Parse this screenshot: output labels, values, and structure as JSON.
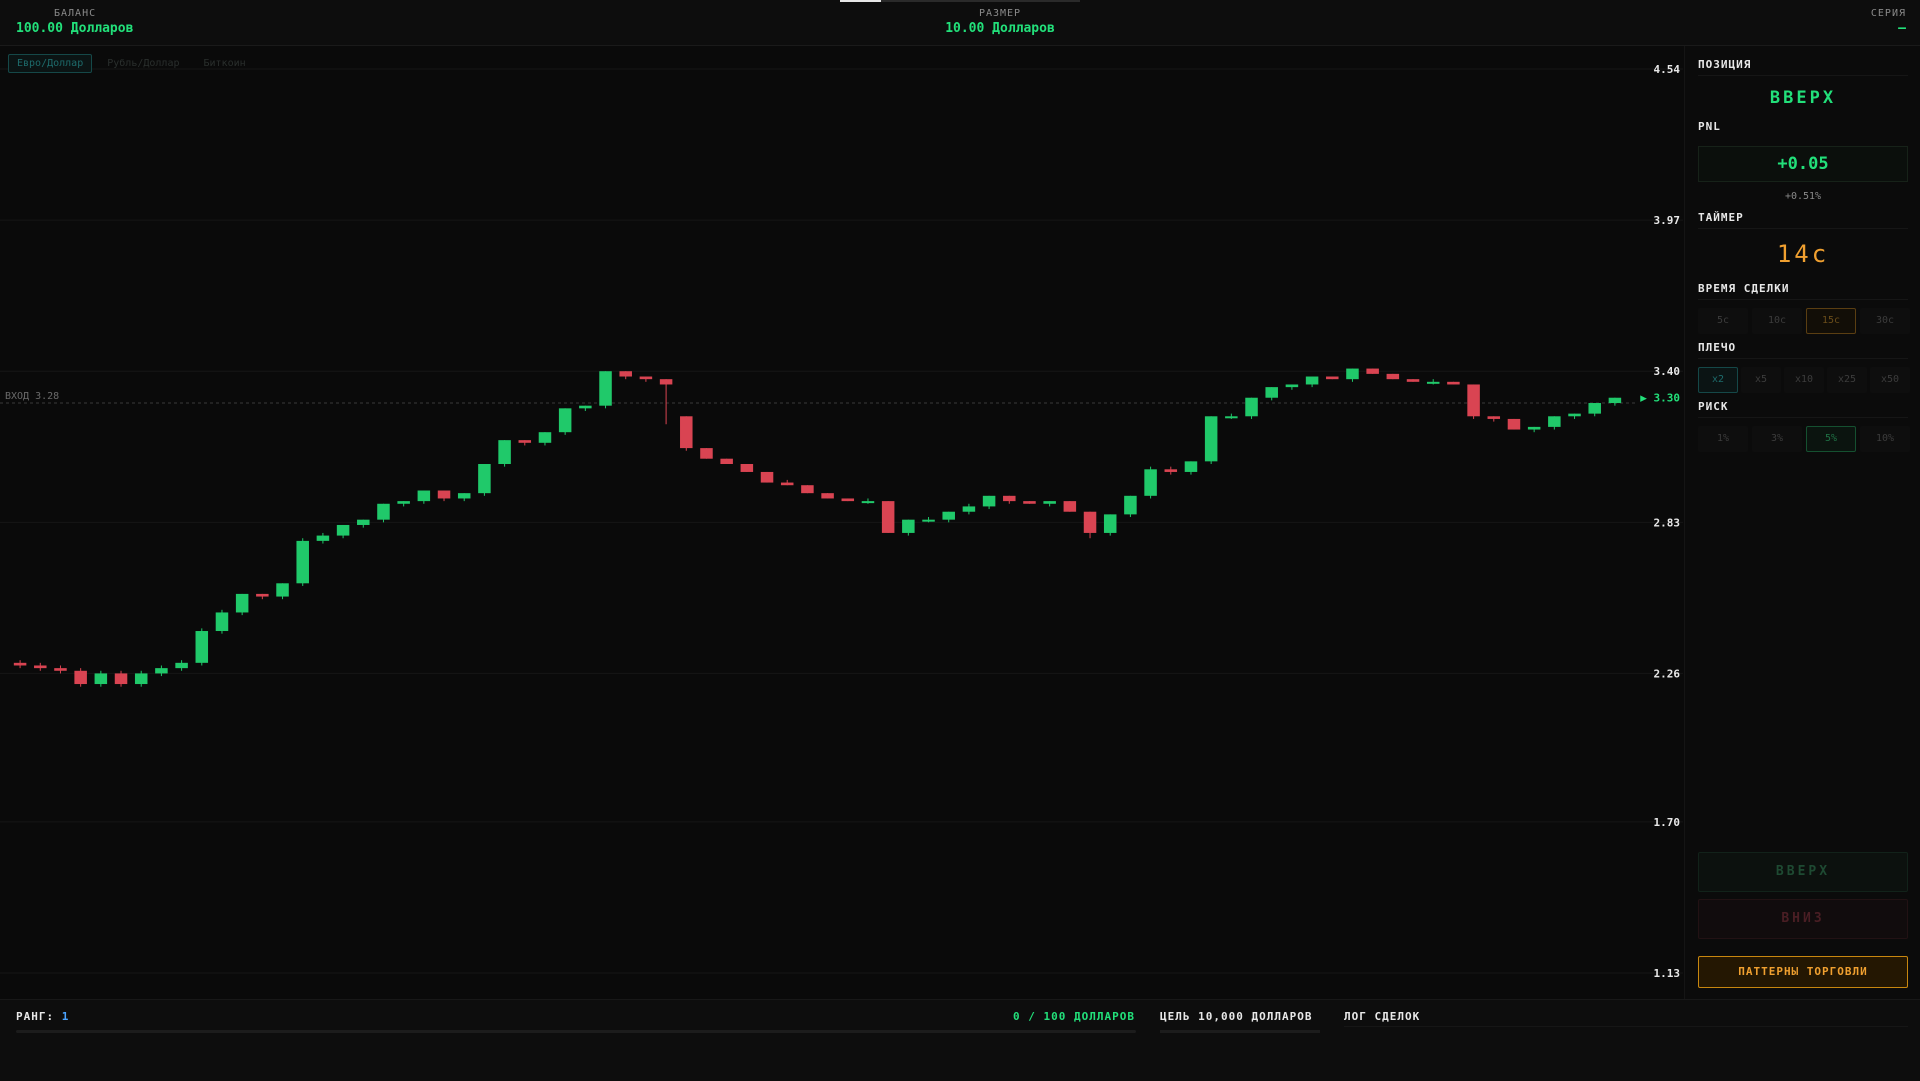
{
  "header": {
    "balance_label": "БАЛАНС",
    "balance_value": "100.00 Долларов",
    "size_label": "РАЗМЕР",
    "size_value": "10.00 Долларов",
    "series_label": "СЕРИЯ",
    "series_value": "—",
    "round_progress": 0.17
  },
  "assets": [
    "Евро/Доллар",
    "Рубль/Доллар",
    "Биткоин"
  ],
  "active_asset": 0,
  "chart_data": {
    "type": "candlestick",
    "y_ticks": [
      "4.54",
      "3.97",
      "3.40",
      "2.83",
      "2.26",
      "1.70",
      "1.13"
    ],
    "ylim": [
      1.13,
      4.54
    ],
    "entry_label": "ВХОД 3.28",
    "entry_price": 3.28,
    "current_price_label": "▶ 3.30",
    "current_price": 3.3,
    "grid": true,
    "candles": [
      [
        2.3,
        2.31,
        2.28,
        2.29
      ],
      [
        2.29,
        2.3,
        2.27,
        2.28
      ],
      [
        2.28,
        2.29,
        2.26,
        2.27
      ],
      [
        2.27,
        2.28,
        2.21,
        2.22
      ],
      [
        2.22,
        2.27,
        2.21,
        2.26
      ],
      [
        2.26,
        2.27,
        2.21,
        2.22
      ],
      [
        2.22,
        2.27,
        2.21,
        2.26
      ],
      [
        2.26,
        2.29,
        2.25,
        2.28
      ],
      [
        2.28,
        2.31,
        2.27,
        2.3
      ],
      [
        2.3,
        2.43,
        2.29,
        2.42
      ],
      [
        2.42,
        2.5,
        2.41,
        2.49
      ],
      [
        2.49,
        2.56,
        2.48,
        2.56
      ],
      [
        2.56,
        2.56,
        2.54,
        2.55
      ],
      [
        2.55,
        2.6,
        2.54,
        2.6
      ],
      [
        2.6,
        2.77,
        2.59,
        2.76
      ],
      [
        2.76,
        2.79,
        2.75,
        2.78
      ],
      [
        2.78,
        2.82,
        2.77,
        2.82
      ],
      [
        2.82,
        2.84,
        2.81,
        2.84
      ],
      [
        2.84,
        2.9,
        2.83,
        2.9
      ],
      [
        2.9,
        2.91,
        2.89,
        2.91
      ],
      [
        2.91,
        2.95,
        2.9,
        2.95
      ],
      [
        2.95,
        2.95,
        2.91,
        2.92
      ],
      [
        2.92,
        2.94,
        2.91,
        2.94
      ],
      [
        2.94,
        3.05,
        2.93,
        3.05
      ],
      [
        3.05,
        3.14,
        3.04,
        3.14
      ],
      [
        3.14,
        3.14,
        3.12,
        3.13
      ],
      [
        3.13,
        3.17,
        3.12,
        3.17
      ],
      [
        3.17,
        3.26,
        3.16,
        3.26
      ],
      [
        3.26,
        3.27,
        3.25,
        3.27
      ],
      [
        3.27,
        3.4,
        3.26,
        3.4
      ],
      [
        3.4,
        3.4,
        3.37,
        3.38
      ],
      [
        3.38,
        3.38,
        3.36,
        3.37
      ],
      [
        3.37,
        3.37,
        3.2,
        3.35
      ],
      [
        3.23,
        3.23,
        3.1,
        3.11
      ],
      [
        3.11,
        3.11,
        3.07,
        3.07
      ],
      [
        3.07,
        3.07,
        3.05,
        3.05
      ],
      [
        3.05,
        3.05,
        3.02,
        3.02
      ],
      [
        3.02,
        3.02,
        2.98,
        2.98
      ],
      [
        2.98,
        2.99,
        2.97,
        2.97
      ],
      [
        2.97,
        2.97,
        2.94,
        2.94
      ],
      [
        2.94,
        2.94,
        2.92,
        2.92
      ],
      [
        2.92,
        2.92,
        2.91,
        2.91
      ],
      [
        2.91,
        2.92,
        2.9,
        2.91
      ],
      [
        2.91,
        2.91,
        2.79,
        2.79
      ],
      [
        2.79,
        2.84,
        2.78,
        2.84
      ],
      [
        2.84,
        2.85,
        2.83,
        2.84
      ],
      [
        2.84,
        2.87,
        2.83,
        2.87
      ],
      [
        2.87,
        2.9,
        2.86,
        2.89
      ],
      [
        2.89,
        2.93,
        2.88,
        2.93
      ],
      [
        2.93,
        2.93,
        2.9,
        2.91
      ],
      [
        2.91,
        2.91,
        2.9,
        2.9
      ],
      [
        2.9,
        2.91,
        2.89,
        2.91
      ],
      [
        2.91,
        2.91,
        2.87,
        2.87
      ],
      [
        2.87,
        2.87,
        2.77,
        2.79
      ],
      [
        2.79,
        2.86,
        2.78,
        2.86
      ],
      [
        2.86,
        2.93,
        2.85,
        2.93
      ],
      [
        2.93,
        3.04,
        2.92,
        3.03
      ],
      [
        3.03,
        3.04,
        3.01,
        3.02
      ],
      [
        3.02,
        3.06,
        3.01,
        3.06
      ],
      [
        3.06,
        3.23,
        3.05,
        3.23
      ],
      [
        3.23,
        3.24,
        3.22,
        3.23
      ],
      [
        3.23,
        3.3,
        3.22,
        3.3
      ],
      [
        3.3,
        3.34,
        3.29,
        3.34
      ],
      [
        3.34,
        3.35,
        3.33,
        3.35
      ],
      [
        3.35,
        3.38,
        3.34,
        3.38
      ],
      [
        3.38,
        3.38,
        3.37,
        3.37
      ],
      [
        3.37,
        3.41,
        3.36,
        3.41
      ],
      [
        3.41,
        3.41,
        3.39,
        3.39
      ],
      [
        3.39,
        3.39,
        3.37,
        3.37
      ],
      [
        3.37,
        3.37,
        3.36,
        3.36
      ],
      [
        3.36,
        3.37,
        3.35,
        3.36
      ],
      [
        3.36,
        3.36,
        3.35,
        3.35
      ],
      [
        3.35,
        3.35,
        3.22,
        3.23
      ],
      [
        3.23,
        3.23,
        3.21,
        3.22
      ],
      [
        3.22,
        3.22,
        3.18,
        3.18
      ],
      [
        3.18,
        3.19,
        3.17,
        3.19
      ],
      [
        3.19,
        3.23,
        3.18,
        3.23
      ],
      [
        3.23,
        3.24,
        3.22,
        3.24
      ],
      [
        3.24,
        3.28,
        3.23,
        3.28
      ],
      [
        3.28,
        3.3,
        3.27,
        3.3
      ]
    ],
    "colors": {
      "up": "#20c96a",
      "down": "#d94452",
      "price": "#22e07a"
    }
  },
  "panel": {
    "position_label": "ПОЗИЦИЯ",
    "position_value": "ВВЕРХ",
    "pnl_label": "PNL",
    "pnl_value": "+0.05",
    "pnl_pct": "+0.51%",
    "timer_label": "ТАЙМЕР",
    "timer_value": "14с",
    "duration_label": "ВРЕМЯ СДЕЛКИ",
    "durations": [
      "5с",
      "10с",
      "15с",
      "30с"
    ],
    "duration_selected": 2,
    "leverage_label": "ПЛЕЧО",
    "leverages": [
      "x2",
      "x5",
      "x10",
      "x25",
      "x50"
    ],
    "leverage_selected": 0,
    "risk_label": "РИСК",
    "risks": [
      "1%",
      "3%",
      "5%",
      "10%"
    ],
    "risk_selected": 2,
    "up_button": "ВВЕРХ",
    "down_button": "ВНИЗ",
    "patterns_button": "ПАТТЕРНЫ ТОРГОВЛИ"
  },
  "footer": {
    "rank_label": "РАНГ:",
    "rank_value": "1",
    "progress_text": "0 / 100 ДОЛЛАРОВ",
    "rank_progress": 0,
    "goal_text": "ЦЕЛЬ 10,000 ДОЛЛАРОВ",
    "log_label": "ЛОГ СДЕЛОК"
  }
}
